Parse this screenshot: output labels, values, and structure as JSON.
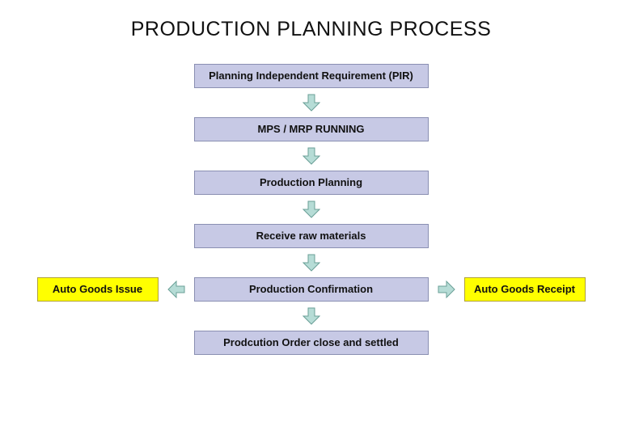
{
  "title": "PRODUCTION PLANNING PROCESS",
  "steps": {
    "pir": "Planning Independent Requirement  (PIR)",
    "mps": "MPS / MRP RUNNING",
    "pp": "Production Planning",
    "raw": "Receive raw materials",
    "confirm": "Production Confirmation",
    "close": "Prodcution Order close and settled"
  },
  "sides": {
    "left": "Auto Goods Issue",
    "right": "Auto Goods Receipt"
  },
  "colors": {
    "box_fill": "#c7c9e5",
    "box_border": "#8a8fb2",
    "side_fill": "#ffff00",
    "side_border": "#b0a13a",
    "arrow_fill": "#b6dcd6",
    "arrow_border": "#6a9f97"
  }
}
